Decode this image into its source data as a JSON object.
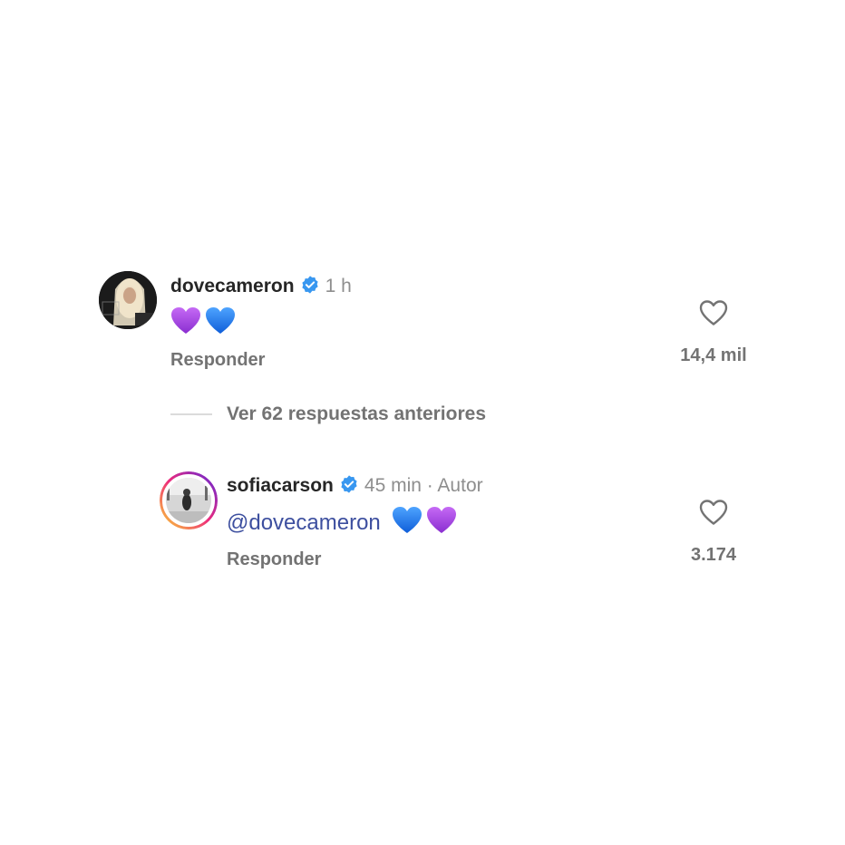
{
  "comments": [
    {
      "username": "dovecameron",
      "time": "1 h",
      "text": "",
      "emojis": [
        "purple-heart",
        "blue-heart"
      ],
      "reply_label": "Responder",
      "like_count": "14,4 mil"
    },
    {
      "username": "sofiacarson",
      "time": "45 min · Autor",
      "mention": "@dovecameron",
      "emojis": [
        "blue-heart",
        "purple-heart"
      ],
      "reply_label": "Responder",
      "like_count": "3.174"
    }
  ],
  "view_replies": "Ver 62 respuestas anteriores",
  "colors": {
    "verified": "#3897f0",
    "purple_heart": "#a63be5",
    "blue_heart": "#1e7cf2",
    "mention": "#3d4f9f",
    "story_ring": [
      "#f9ce34",
      "#ee2a7b",
      "#6228d7"
    ]
  }
}
